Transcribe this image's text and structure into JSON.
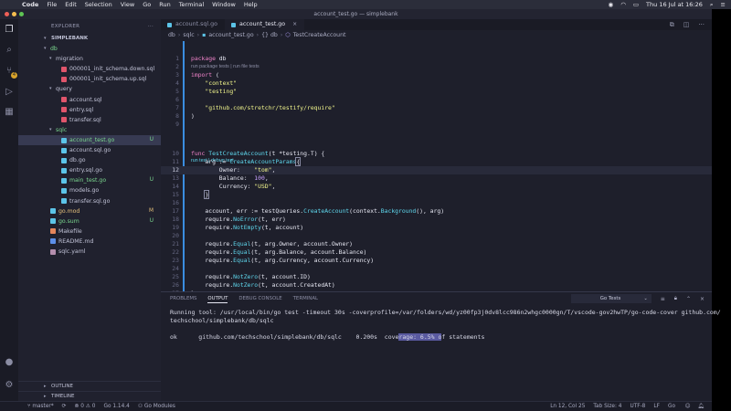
{
  "menubar": {
    "app_name": "Code",
    "items": [
      "File",
      "Edit",
      "Selection",
      "View",
      "Go",
      "Run",
      "Terminal",
      "Window",
      "Help"
    ],
    "clock": "Thu 16 Jul at 16:26"
  },
  "window": {
    "title": "account_test.go — simplebank"
  },
  "activity_bar": {
    "scm_badge": "4"
  },
  "sidebar": {
    "header": "EXPLORER",
    "project": "SIMPLEBANK",
    "outline_label": "OUTLINE",
    "timeline_label": "TIMELINE",
    "tree": [
      {
        "label": "db",
        "kind": "folder",
        "depth": 1,
        "open": true,
        "status": "",
        "color": "#7bd88f"
      },
      {
        "label": "migration",
        "kind": "folder",
        "depth": 2,
        "open": true,
        "status": "",
        "color": "#c0c2d6"
      },
      {
        "label": "000001_init_schema.down.sql",
        "kind": "file",
        "depth": 3,
        "status": "",
        "color": "#c0c2d6",
        "icon": "#e0556b"
      },
      {
        "label": "000001_init_schema.up.sql",
        "kind": "file",
        "depth": 3,
        "status": "",
        "color": "#c0c2d6",
        "icon": "#e0556b"
      },
      {
        "label": "query",
        "kind": "folder",
        "depth": 2,
        "open": true,
        "status": "",
        "color": "#c0c2d6"
      },
      {
        "label": "account.sql",
        "kind": "file",
        "depth": 3,
        "status": "",
        "color": "#c0c2d6",
        "icon": "#e0556b"
      },
      {
        "label": "entry.sql",
        "kind": "file",
        "depth": 3,
        "status": "",
        "color": "#c0c2d6",
        "icon": "#e0556b"
      },
      {
        "label": "transfer.sql",
        "kind": "file",
        "depth": 3,
        "status": "",
        "color": "#c0c2d6",
        "icon": "#e0556b"
      },
      {
        "label": "sqlc",
        "kind": "folder",
        "depth": 2,
        "open": true,
        "status": "",
        "color": "#7bd88f"
      },
      {
        "label": "account_test.go",
        "kind": "file",
        "depth": 3,
        "status": "U",
        "color": "#7bd88f",
        "icon": "#5cc4e8",
        "selected": true
      },
      {
        "label": "account.sql.go",
        "kind": "file",
        "depth": 3,
        "status": "",
        "color": "#c0c2d6",
        "icon": "#5cc4e8"
      },
      {
        "label": "db.go",
        "kind": "file",
        "depth": 3,
        "status": "",
        "color": "#c0c2d6",
        "icon": "#5cc4e8"
      },
      {
        "label": "entry.sql.go",
        "kind": "file",
        "depth": 3,
        "status": "",
        "color": "#c0c2d6",
        "icon": "#5cc4e8"
      },
      {
        "label": "main_test.go",
        "kind": "file",
        "depth": 3,
        "status": "U",
        "color": "#7bd88f",
        "icon": "#5cc4e8"
      },
      {
        "label": "models.go",
        "kind": "file",
        "depth": 3,
        "status": "",
        "color": "#c0c2d6",
        "icon": "#5cc4e8"
      },
      {
        "label": "transfer.sql.go",
        "kind": "file",
        "depth": 3,
        "status": "",
        "color": "#c0c2d6",
        "icon": "#5cc4e8"
      },
      {
        "label": "go.mod",
        "kind": "file",
        "depth": 1,
        "status": "M",
        "color": "#e5c07b",
        "icon": "#5cc4e8"
      },
      {
        "label": "go.sum",
        "kind": "file",
        "depth": 1,
        "status": "U",
        "color": "#7bd88f",
        "icon": "#5cc4e8"
      },
      {
        "label": "Makefile",
        "kind": "file",
        "depth": 1,
        "status": "",
        "color": "#c0c2d6",
        "icon": "#e5865b"
      },
      {
        "label": "README.md",
        "kind": "file",
        "depth": 1,
        "status": "",
        "color": "#c0c2d6",
        "icon": "#5c8fe8"
      },
      {
        "label": "sqlc.yaml",
        "kind": "file",
        "depth": 1,
        "status": "",
        "color": "#c0c2d6",
        "icon": "#b48ead"
      }
    ]
  },
  "editor": {
    "tabs": [
      {
        "label": "account.sql.go",
        "active": false
      },
      {
        "label": "account_test.go",
        "active": true
      }
    ],
    "breadcrumb": [
      "db",
      "sqlc",
      "account_test.go",
      "{} db",
      "TestCreateAccount"
    ],
    "code_lens": {
      "package": "run package tests | run file tests",
      "function": "run test | debug test"
    },
    "lines": [
      {
        "n": "1",
        "html": "<span class='kw'>package</span> <span class='pl'>db</span>"
      },
      {
        "n": "2",
        "html": ""
      },
      {
        "n": "3",
        "html": "<span class='kw'>import</span> <span class='pl'>(</span>"
      },
      {
        "n": "4",
        "html": "    <span class='str'>\"context\"</span>"
      },
      {
        "n": "5",
        "html": "    <span class='str'>\"testing\"</span>"
      },
      {
        "n": "6",
        "html": ""
      },
      {
        "n": "7",
        "html": "    <span class='str'>\"github.com/stretchr/testify/require\"</span>"
      },
      {
        "n": "8",
        "html": "<span class='pl'>)</span>"
      },
      {
        "n": "9",
        "html": ""
      },
      {
        "n": "10",
        "html": "<span class='kw'>func</span> <span class='fn'>TestCreateAccount</span><span class='pl'>(t *testing.T) {</span>"
      },
      {
        "n": "11",
        "html": "    <span class='pl'>arg := </span><span class='fn'>CreateAccountParams</span><span class='pl bracket'>{</span>"
      },
      {
        "n": "12",
        "html": "        <span class='pl'>Owner:    </span><span class='str'>\"tom\"</span><span class='pl'>,</span>"
      },
      {
        "n": "13",
        "html": "        <span class='pl'>Balance:  </span><span class='nm'>100</span><span class='pl'>,</span>"
      },
      {
        "n": "14",
        "html": "        <span class='pl'>Currency: </span><span class='str'>\"USD\"</span><span class='pl'>,</span>"
      },
      {
        "n": "15",
        "html": "    <span class='pl bracket'>}</span>"
      },
      {
        "n": "16",
        "html": ""
      },
      {
        "n": "17",
        "html": "    <span class='pl'>account, err := testQueries.</span><span class='fn'>CreateAccount</span><span class='pl'>(context.</span><span class='fn'>Background</span><span class='pl'>(), arg)</span>"
      },
      {
        "n": "18",
        "html": "    <span class='pl'>require.</span><span class='fn'>NoError</span><span class='pl'>(t, err)</span>"
      },
      {
        "n": "19",
        "html": "    <span class='pl'>require.</span><span class='fn'>NotEmpty</span><span class='pl'>(t, account)</span>"
      },
      {
        "n": "20",
        "html": ""
      },
      {
        "n": "21",
        "html": "    <span class='pl'>require.</span><span class='fn'>Equal</span><span class='pl'>(t, arg.Owner, account.Owner)</span>"
      },
      {
        "n": "22",
        "html": "    <span class='pl'>require.</span><span class='fn'>Equal</span><span class='pl'>(t, arg.Balance, account.Balance)</span>"
      },
      {
        "n": "23",
        "html": "    <span class='pl'>require.</span><span class='fn'>Equal</span><span class='pl'>(t, arg.Currency, account.Currency)</span>"
      },
      {
        "n": "24",
        "html": ""
      },
      {
        "n": "25",
        "html": "    <span class='pl'>require.</span><span class='fn'>NotZero</span><span class='pl'>(t, account.ID)</span>"
      },
      {
        "n": "26",
        "html": "    <span class='pl'>require.</span><span class='fn'>NotZero</span><span class='pl'>(t, account.CreatedAt)</span>"
      },
      {
        "n": "27",
        "html": "<span class='pl'>}</span>"
      }
    ],
    "current_line": "12"
  },
  "panel": {
    "tabs": [
      {
        "label": "PROBLEMS",
        "active": false
      },
      {
        "label": "OUTPUT",
        "active": true
      },
      {
        "label": "DEBUG CONSOLE",
        "active": false
      },
      {
        "label": "TERMINAL",
        "active": false
      }
    ],
    "output_channel": "Go Tests",
    "output_line1": "Running tool: /usr/local/bin/go test -timeout 30s -coverprofile=/var/folders/wd/yz00fp3j0dv8lcc986n2whgc0000gn/T/vscode-gov2hwTP/go-code-cover github.com/",
    "output_line2": "techschool/simplebank/db/sqlc",
    "output_result_prefix": "ok      github.com/techschool/simplebank/db/sqlc    0.200s  cove",
    "output_result_highlight": "rage: 6.5% o",
    "output_result_suffix": "f statements"
  },
  "statusbar": {
    "branch": "master*",
    "sync": "⟳",
    "problems": "⊗ 0 ⚠ 0",
    "go_version": "Go 1.14.4",
    "go_modules": "Go Modules",
    "position": "Ln 12, Col 25",
    "tab_size": "Tab Size: 4",
    "encoding": "UTF-8",
    "eol": "LF",
    "language": "Go"
  }
}
